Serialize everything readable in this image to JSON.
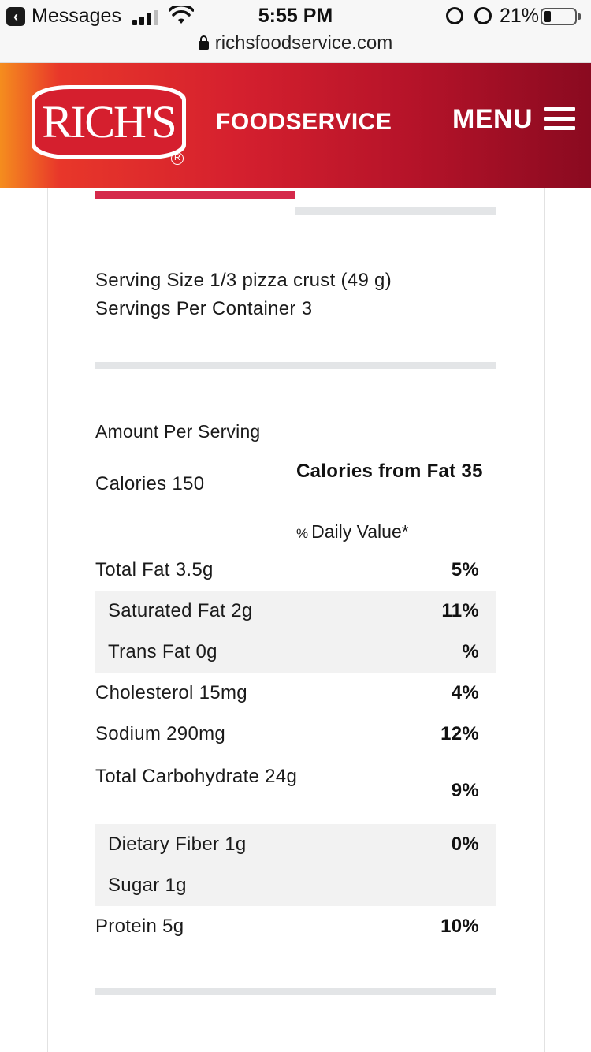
{
  "status_bar": {
    "back_app": "Messages",
    "time": "5:55 PM",
    "battery": "21%"
  },
  "browser": {
    "url": "richsfoodservice.com"
  },
  "header": {
    "logo_text": "RICH'S",
    "logo_registered": "R",
    "brand_sub": "FOODSERVICE",
    "menu_label": "MENU"
  },
  "serving": {
    "size": "Serving Size 1/3 pizza crust (49 g)",
    "per_container": "Servings Per Container 3"
  },
  "nutrition": {
    "amount_per_serving": "Amount Per Serving",
    "calories": "Calories 150",
    "calories_from_fat": "Calories from Fat 35",
    "dv_symbol": "%",
    "dv_header": "Daily Value*",
    "rows": [
      {
        "label": "Total Fat 3.5g",
        "value": "5%"
      },
      {
        "label": "Saturated Fat 2g",
        "value": "11%"
      },
      {
        "label": "Trans Fat 0g",
        "value": "%"
      },
      {
        "label": "Cholesterol 15mg",
        "value": "4%"
      },
      {
        "label": "Sodium 290mg",
        "value": "12%"
      },
      {
        "label": "Total Carbohydrate 24g",
        "value": "9%"
      },
      {
        "label": "Dietary Fiber 1g",
        "value": "0%"
      },
      {
        "label": "Sugar 1g",
        "value": ""
      },
      {
        "label": "Protein 5g",
        "value": "10%"
      }
    ]
  },
  "colors": {
    "brand_red": "#d5202e",
    "header_orange": "#f58d1e",
    "header_dark": "#8a0a20",
    "tab_active": "#d5294a",
    "divider": "#e3e5e7",
    "row_shade": "#f2f2f2"
  },
  "icons": [
    "back-icon",
    "signal-icon",
    "wifi-icon",
    "rotation-lock-icon",
    "alarm-icon",
    "battery-icon",
    "lock-icon",
    "hamburger-menu-icon"
  ]
}
